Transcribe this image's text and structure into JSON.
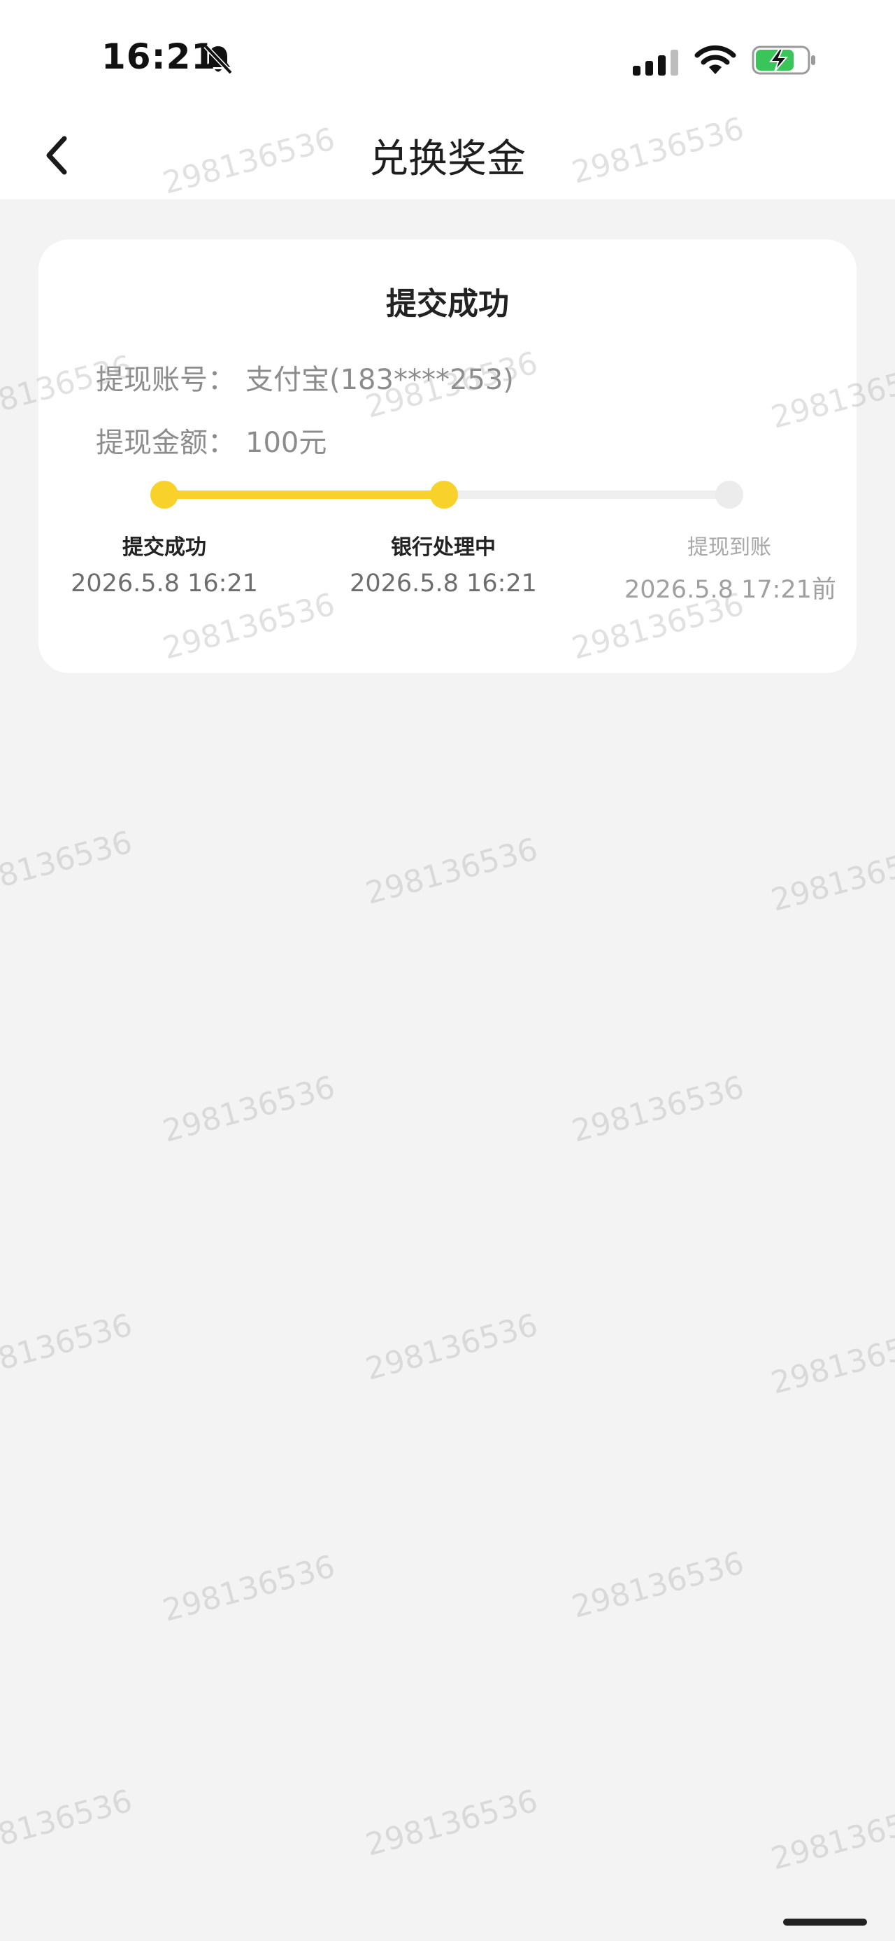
{
  "status_bar": {
    "time": "16:21",
    "icons": [
      "bell-muted-icon",
      "signal-icon",
      "wifi-icon",
      "battery-charging-icon"
    ]
  },
  "nav": {
    "title": "兑换奖金",
    "back_icon": "chevron-left-icon"
  },
  "card": {
    "title": "提交成功",
    "account_label": "提现账号：",
    "account_value": "支付宝(183****253)",
    "amount_label": "提现金额：",
    "amount_value": "100元",
    "steps": [
      {
        "label": "提交成功",
        "time": "2026.5.8 16:21",
        "state": "done"
      },
      {
        "label": "银行处理中",
        "time": "2026.5.8 16:21",
        "state": "done"
      },
      {
        "label": "提现到账",
        "time": "2026.5.8 17:21前",
        "state": "pending"
      }
    ]
  },
  "watermark": "298136536",
  "colors": {
    "accent": "#f8d22a",
    "background": "#f3f3f3",
    "card": "#ffffff",
    "muted_text": "#8c8c8c"
  }
}
